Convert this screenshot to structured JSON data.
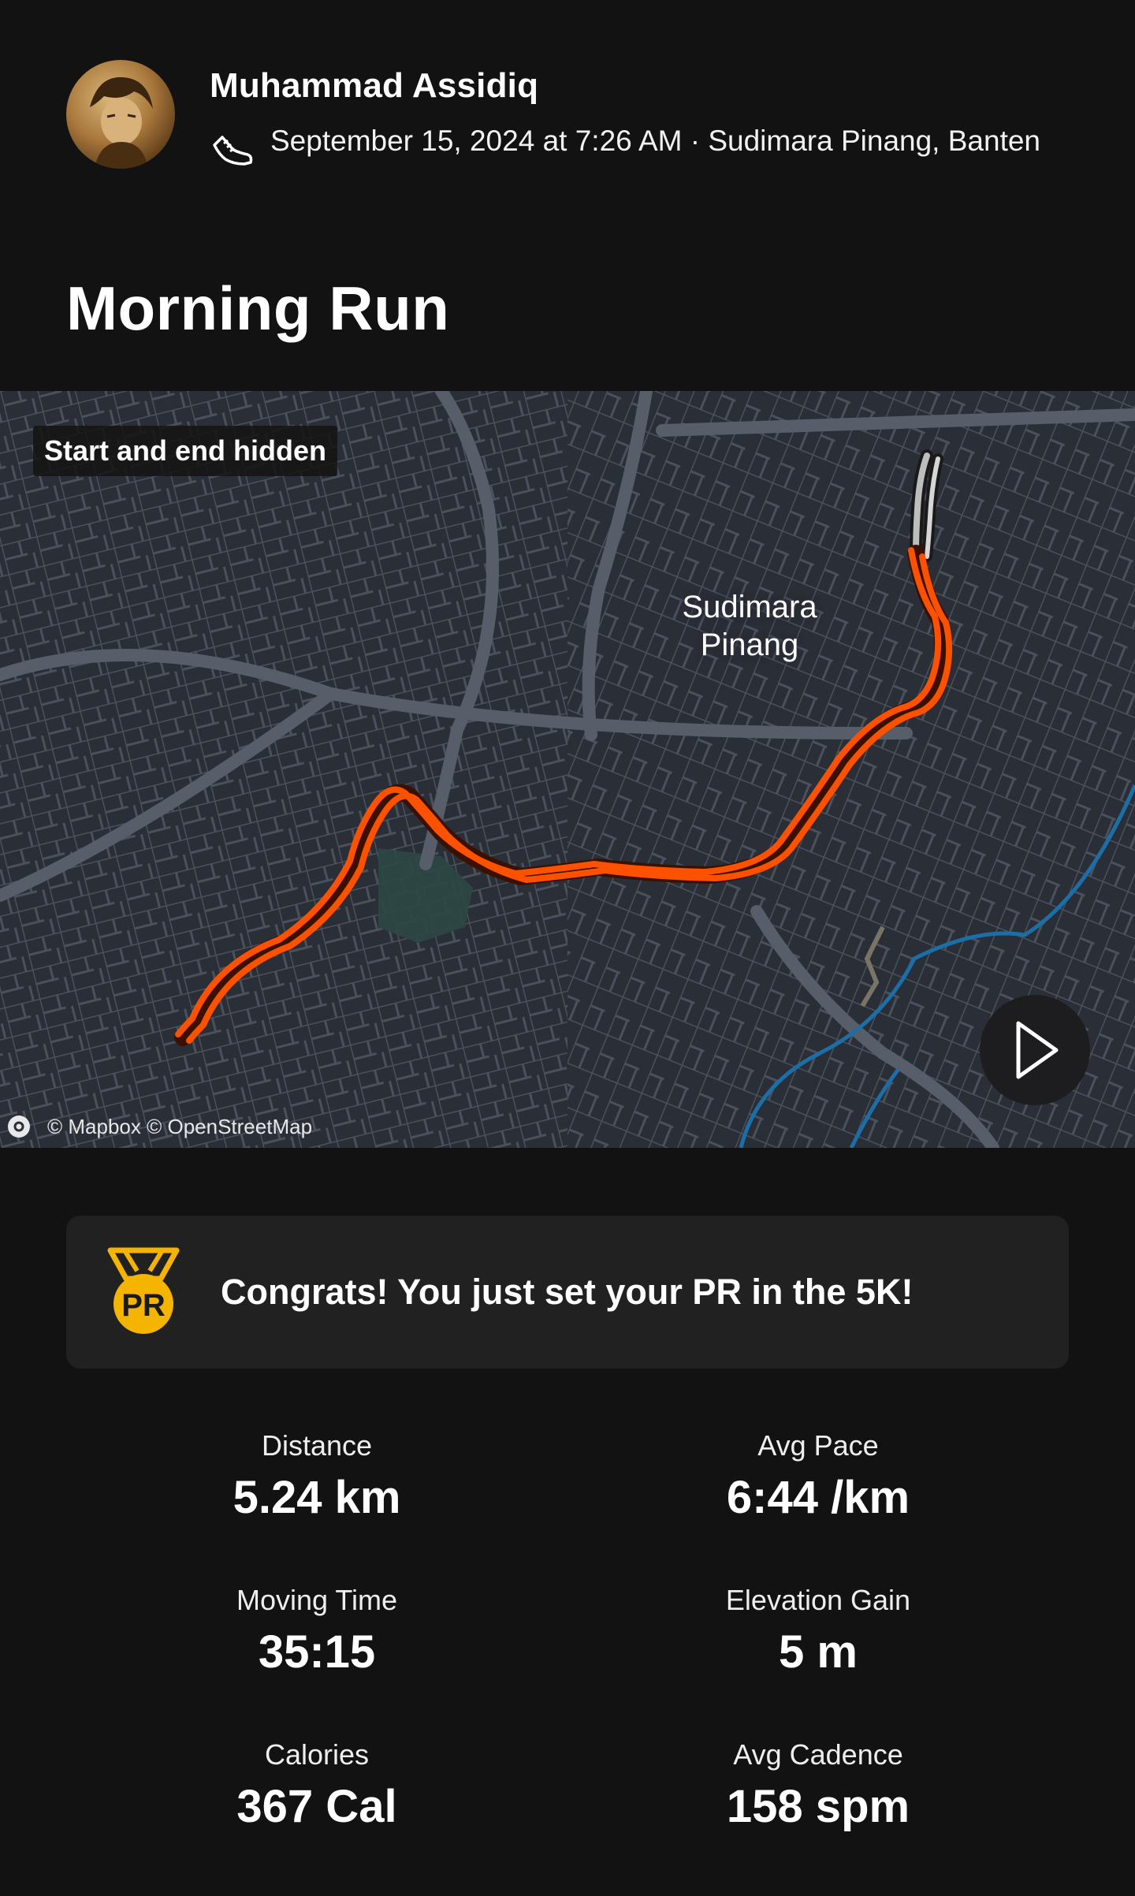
{
  "athlete": {
    "name": "Muhammad Assidiq",
    "datetime_location": "September 15, 2024 at 7:26 AM · Sudimara Pinang, Banten"
  },
  "activity": {
    "title": "Morning Run",
    "type_icon": "running-shoe-icon"
  },
  "map": {
    "badge": "Start and end hidden",
    "place_label": "Sudimara Pinang",
    "attribution": "© Mapbox © OpenStreetMap",
    "play_icon": "play-icon",
    "route_color": "#fc5200",
    "hidden_segment_color": "#bdbdbd"
  },
  "achievement": {
    "text": "Congrats! You just set your PR in the 5K!",
    "icon": "pr-medal-icon",
    "icon_text": "PR",
    "color": "#f4b400"
  },
  "stats": [
    {
      "label": "Distance",
      "value": "5.24 km"
    },
    {
      "label": "Avg Pace",
      "value": "6:44 /km"
    },
    {
      "label": "Moving Time",
      "value": "35:15"
    },
    {
      "label": "Elevation Gain",
      "value": "5 m"
    },
    {
      "label": "Calories",
      "value": "367 Cal"
    },
    {
      "label": "Avg Cadence",
      "value": "158 spm"
    }
  ]
}
